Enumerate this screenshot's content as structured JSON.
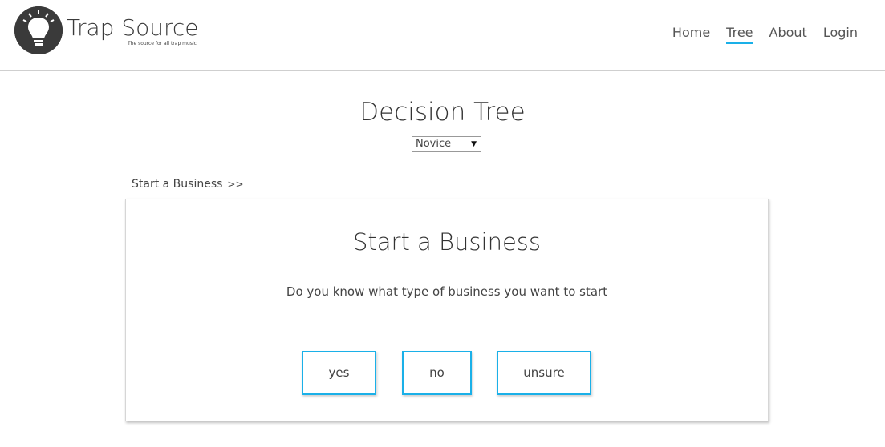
{
  "brand": {
    "name": "Trap Source",
    "tagline": "The source for all trap music",
    "logo_icon": "lightbulb-icon"
  },
  "nav": {
    "items": [
      {
        "label": "Home",
        "active": false
      },
      {
        "label": "Tree",
        "active": true
      },
      {
        "label": "About",
        "active": false
      },
      {
        "label": "Login",
        "active": false
      }
    ]
  },
  "page": {
    "title": "Decision Tree",
    "level_select": {
      "value": "Novice"
    }
  },
  "breadcrumb": {
    "current": "Start a Business",
    "separator": ">>"
  },
  "card": {
    "title": "Start a Business",
    "question": "Do you know what type of business you want to start",
    "answers": [
      "yes",
      "no",
      "unsure"
    ]
  },
  "colors": {
    "accent": "#1ab0e8",
    "logo_dark": "#3a3a3a"
  }
}
